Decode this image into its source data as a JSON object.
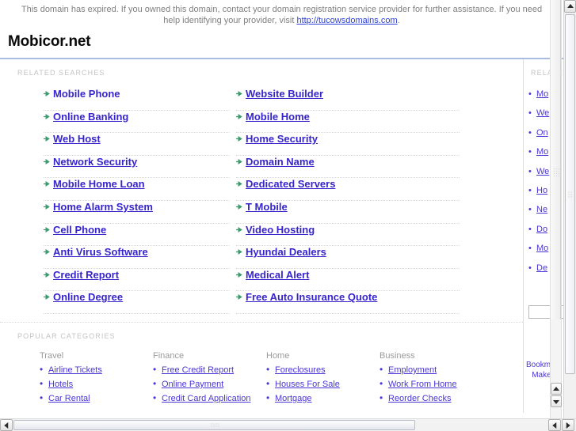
{
  "banner": {
    "text_before": "This domain has expired. If you owned this domain, contact your domain registration service provider for further assistance. If you need help identifying your provider, visit ",
    "link_text": "http://tucowsdomains.com",
    "text_after": "."
  },
  "header": {
    "site_title": "Mobicor.net"
  },
  "main": {
    "related_label": "RELATED SEARCHES",
    "popular_label": "POPULAR CATEGORIES",
    "related_links_col1": [
      {
        "label": "Mobile Phone",
        "underlined": false
      },
      {
        "label": "Online Banking",
        "underlined": true
      },
      {
        "label": "Web Host",
        "underlined": true
      },
      {
        "label": "Network Security",
        "underlined": true
      },
      {
        "label": "Mobile Home Loan",
        "underlined": true
      },
      {
        "label": "Home Alarm System",
        "underlined": true
      },
      {
        "label": "Cell Phone",
        "underlined": true
      },
      {
        "label": "Anti Virus Software",
        "underlined": true
      },
      {
        "label": "Credit Report",
        "underlined": true
      },
      {
        "label": "Online Degree",
        "underlined": true
      }
    ],
    "related_links_col2": [
      {
        "label": "Website Builder",
        "underlined": true
      },
      {
        "label": "Mobile Home",
        "underlined": true
      },
      {
        "label": "Home Security",
        "underlined": true
      },
      {
        "label": "Domain Name",
        "underlined": true
      },
      {
        "label": "Dedicated Servers",
        "underlined": true
      },
      {
        "label": "T Mobile",
        "underlined": true
      },
      {
        "label": "Video Hosting",
        "underlined": true
      },
      {
        "label": "Hyundai Dealers",
        "underlined": true
      },
      {
        "label": "Medical Alert",
        "underlined": true
      },
      {
        "label": "Free Auto Insurance Quote",
        "underlined": true
      }
    ],
    "categories": [
      {
        "heading": "Travel",
        "items": [
          "Airline Tickets",
          "Hotels",
          "Car Rental"
        ]
      },
      {
        "heading": "Finance",
        "items": [
          "Free Credit Report",
          "Online Payment",
          "Credit Card Application"
        ]
      },
      {
        "heading": "Home",
        "items": [
          "Foreclosures",
          "Houses For Sale",
          "Mortgage"
        ]
      },
      {
        "heading": "Business",
        "items": [
          "Employment",
          "Work From Home",
          "Reorder Checks"
        ]
      }
    ]
  },
  "sidebar": {
    "related_label": "RELATED",
    "links": [
      "Mo",
      "We",
      "On",
      "Mo",
      "We",
      "Ho",
      "Ne",
      "Do",
      "Mo",
      "De"
    ],
    "search_value": "",
    "search_placeholder": "",
    "footer_links": [
      "Bookmark",
      "Make thi"
    ]
  },
  "colors": {
    "link": "#3725cc",
    "small_link": "#4a36d6",
    "arrow_bullet": "#3d9b6e",
    "section_label": "#c3c3c3",
    "banner_text": "#808080",
    "banner_link": "#2c3fd8",
    "rule": "#a8bde0"
  }
}
